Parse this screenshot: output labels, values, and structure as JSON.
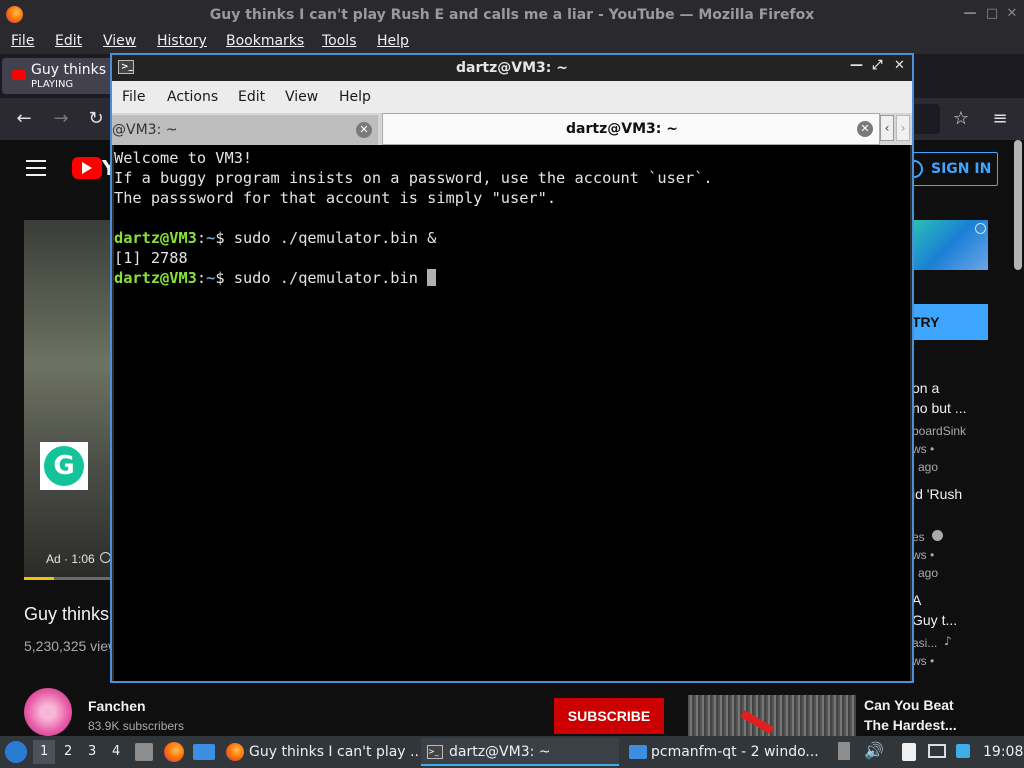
{
  "firefox": {
    "window_title": "Guy thinks I can't play Rush E and calls me a liar - YouTube — Mozilla Firefox",
    "menu": [
      "File",
      "Edit",
      "View",
      "History",
      "Bookmarks",
      "Tools",
      "Help"
    ],
    "tab": {
      "title": "Guy thinks I",
      "status": "PLAYING"
    },
    "window_buttons": {
      "minimize": "—",
      "maximize": "□",
      "close": "✕"
    }
  },
  "youtube": {
    "logo_text": "Y",
    "sign_in": "SIGN IN",
    "ad_label": "Ad · 1:06",
    "video_title_partial": "Guy thinks",
    "views_partial": "5,230,325 view",
    "channel": {
      "name": "Fanchen",
      "subscribers": "83.9K subscribers"
    },
    "subscribe": "SUBSCRIBE",
    "try_now": "TRY NOW",
    "sidebar": [
      {
        "l1": "on a",
        "l2": "no but ...",
        "channel": "boardSink",
        "meta1": "ws •",
        "meta2": "ago"
      },
      {
        "l1": "id 'Rush",
        "channel": "es",
        "meta1": "ws •",
        "meta2": "ago"
      },
      {
        "l1": "A",
        "l2": "Guy t...",
        "channel": "asi...",
        "meta1": "ws •"
      }
    ],
    "rec_bottom": {
      "l1": "Can You Beat",
      "l2": "The Hardest..."
    }
  },
  "terminal": {
    "window_title": "dartz@VM3: ~",
    "menu": [
      "File",
      "Actions",
      "Edit",
      "View",
      "Help"
    ],
    "tabs": [
      "@VM3: ~",
      "dartz@VM3: ~"
    ],
    "lines": {
      "l1": "Welcome to VM3!",
      "l2": "If a buggy program insists on a password, use the account `user`.",
      "l3": "The passsword for that account is simply \"user\".",
      "prompt_user": "dartz@VM3",
      "prompt_colon": ":",
      "prompt_path": "~",
      "prompt_dollar": "$ ",
      "cmd1": "sudo ./qemulator.bin &",
      "job": "[1] 2788",
      "cmd2": "sudo ./qemulator.bin "
    }
  },
  "taskbar": {
    "desktops": [
      "1",
      "2",
      "3",
      "4"
    ],
    "tasks": [
      {
        "label": "Guy thinks I can't play ...",
        "icon": "firefox-icon"
      },
      {
        "label": "dartz@VM3: ~",
        "icon": "terminal-icon"
      },
      {
        "label": "pcmanfm-qt - 2 windo...",
        "icon": "folder-icon"
      }
    ],
    "clock": "19:08"
  },
  "colors": {
    "accent": "#4a90d9",
    "prompt_green": "#8ae234",
    "prompt_blue": "#729fcf",
    "yt_red": "#cc0000",
    "yt_blue": "#3ea6ff"
  }
}
